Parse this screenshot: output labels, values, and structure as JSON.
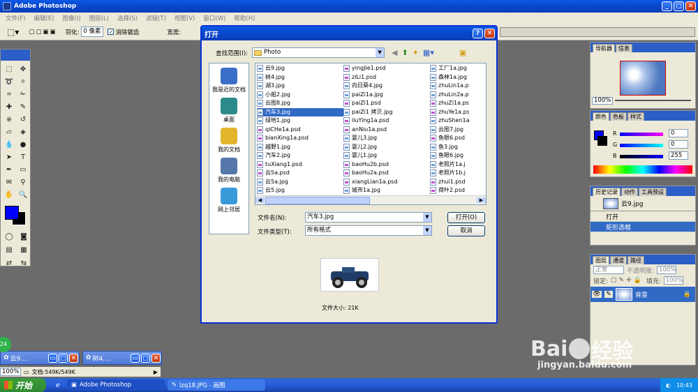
{
  "app": {
    "title": "Adobe Photoshop",
    "menu": [
      "文件(F)",
      "编辑(E)",
      "图像(I)",
      "图层(L)",
      "选择(S)",
      "滤镜(T)",
      "视图(V)",
      "窗口(W)",
      "帮助(H)"
    ]
  },
  "options": {
    "feather_label": "羽化:",
    "feather_value": "0 像素",
    "antialias_label": "消除锯齿",
    "width_label": "宽度:"
  },
  "dialog": {
    "title": "打开",
    "lookin_label": "查找范围(I):",
    "lookin_value": "Photo",
    "places": [
      "我是近的文档",
      "桌面",
      "我的文档",
      "我的电脑",
      "网上邻居"
    ],
    "col1": [
      "云9.jpg",
      "树4.jpg",
      "湖3.jpg",
      "小船2.jpg",
      "云图8.jpg",
      "汽车3.jpg",
      "绿地1.jpg",
      "qiCHe1a.psd",
      "bianXing1a.psd",
      "越野1.jpg",
      "汽车2.jpg",
      "tuXiang1.psd",
      "云5a.psd",
      "云5a.jpg",
      "云5.jpg"
    ],
    "col2": [
      "yingJie1.psd",
      "ziLi1.psd",
      "向日葵4.jpg",
      "paiZi1a.jpg",
      "paiZi1.psd",
      "paiZi1 拷贝.jpg",
      "liuYing1a.psd",
      "anNiu1a.psd",
      "婴儿3.jpg",
      "婴儿2.jpg",
      "婴儿1.jpg",
      "baoHu2b.psd",
      "baoHu2a.psd",
      "xiangLian1a.psd",
      "城市1a.jpg"
    ],
    "col3": [
      "工厂1a.jpg",
      "森林1a.jpg",
      "zhuLin1a.p",
      "zhuLin2a.p",
      "zhuZi1a.psd",
      "zhuYe1a.psd",
      "zhuShen1a.",
      "云图7.jpg",
      "鱼眼6.psd",
      "鱼3.jpg",
      "鱼眼6.jpg",
      "老照片1a.j",
      "老照片1b.j",
      "zhui1.psd",
      "荷叶2.psd"
    ],
    "filename_label": "文件名(N):",
    "filename_value": "汽车3.jpg",
    "filetype_label": "文件类型(T):",
    "filetype_value": "所有格式",
    "open_btn": "打开(O)",
    "cancel_btn": "取消",
    "filesize": "文件大小: 21K"
  },
  "navigator": {
    "tabs": [
      "导航器",
      "信息"
    ],
    "zoom": "100%"
  },
  "color": {
    "tabs": [
      "颜色",
      "色板",
      "样式"
    ],
    "r_label": "R",
    "g_label": "G",
    "b_label": "B",
    "r": "0",
    "g": "0",
    "b": "255"
  },
  "history": {
    "tabs": [
      "历史记录",
      "动作",
      "工具预设"
    ],
    "snapshot": "云9.jpg",
    "items": [
      "打开",
      "矩形选框"
    ]
  },
  "layers": {
    "tabs": [
      "图层",
      "通道",
      "路径"
    ],
    "mode": "正常",
    "opacity_label": "不透明度:",
    "opacity": "100%",
    "lock_label": "锁定:",
    "fill_label": "填充:",
    "fill": "100%",
    "layer_name": "背景"
  },
  "docs": [
    {
      "title": "云9...."
    },
    {
      "title": "树4...."
    }
  ],
  "status": {
    "zoom": "100%",
    "doc": "文档:549K/549K"
  },
  "taskbar": {
    "start": "开始",
    "items": [
      "Adobe Photoshop",
      "lzq18.JPG - 画图"
    ],
    "time": "10:43",
    "badge": "24"
  },
  "watermark": {
    "brand": "Bai",
    "suffix": "经验",
    "url": "jingyan.baidu.com"
  }
}
